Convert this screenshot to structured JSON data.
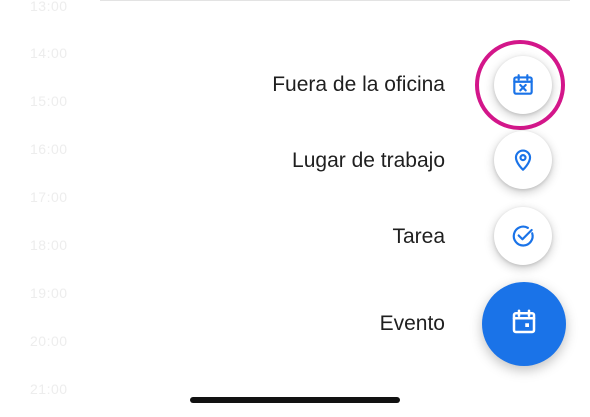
{
  "background_times": [
    "13:00",
    "14:00",
    "15:00",
    "16:00",
    "17:00",
    "18:00",
    "19:00",
    "20:00",
    "21:00"
  ],
  "menu": {
    "items": [
      {
        "label": "Fuera de la oficina",
        "icon": "calendar-x-icon"
      },
      {
        "label": "Lugar de trabajo",
        "icon": "location-pin-icon"
      },
      {
        "label": "Tarea",
        "icon": "check-circle-icon"
      },
      {
        "label": "Evento",
        "icon": "calendar-event-icon"
      }
    ]
  },
  "colors": {
    "accent": "#1a73e8",
    "highlight_ring": "#d3168a",
    "label_text": "#1f1f1f"
  }
}
